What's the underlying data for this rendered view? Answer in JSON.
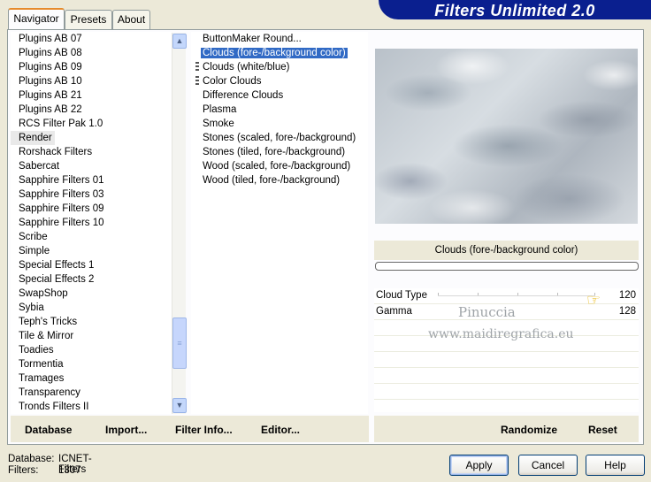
{
  "header": {
    "title": "Filters Unlimited 2.0"
  },
  "tabs": [
    {
      "label": "Navigator",
      "active": true
    },
    {
      "label": "Presets",
      "active": false
    },
    {
      "label": "About",
      "active": false
    }
  ],
  "categories": {
    "items": [
      "Plugins AB 07",
      "Plugins AB 08",
      "Plugins AB 09",
      "Plugins AB 10",
      "Plugins AB 21",
      "Plugins AB 22",
      "RCS Filter Pak 1.0",
      "Render",
      "Rorshack Filters",
      "Sabercat",
      "Sapphire Filters 01",
      "Sapphire Filters 03",
      "Sapphire Filters 09",
      "Sapphire Filters 10",
      "Scribe",
      "Simple",
      "Special Effects 1",
      "Special Effects 2",
      "SwapShop",
      "Sybia",
      "Teph's Tricks",
      "Tile & Mirror",
      "Toadies",
      "Tormentia",
      "Tramages",
      "Transparency",
      "Tronds Filters II"
    ],
    "selected": "Render"
  },
  "filters": {
    "items": [
      "ButtonMaker Round...",
      "Clouds (fore-/background color)",
      "Clouds (white/blue)",
      "Color Clouds",
      "Difference Clouds",
      "Plasma",
      "Smoke",
      "Stones (scaled, fore-/background)",
      "Stones (tiled, fore-/background)",
      "Wood (scaled, fore-/background)",
      "Wood (tiled, fore-/background)"
    ],
    "selected": "Clouds (fore-/background color)"
  },
  "preview": {
    "filter_name": "Clouds (fore-/background color)",
    "params": [
      {
        "label": "Cloud Type",
        "value": "120"
      },
      {
        "label": "Gamma",
        "value": "128"
      }
    ],
    "watermark_line1": "Pinuccia",
    "watermark_line2": "www.maidiregrafica.eu"
  },
  "bottom_buttons": {
    "database": "Database",
    "import": "Import...",
    "filter_info": "Filter Info...",
    "editor": "Editor...",
    "randomize": "Randomize",
    "reset": "Reset"
  },
  "status": {
    "database_label": "Database:",
    "database_value": "ICNET-Filters",
    "filters_label": "Filters:",
    "filters_value": "1307"
  },
  "dialog_buttons": {
    "apply": "Apply",
    "cancel": "Cancel",
    "help": "Help"
  },
  "colors": {
    "selection": "#316ac5",
    "header": "#0a1f8f",
    "tab_accent": "#e68b2c"
  }
}
